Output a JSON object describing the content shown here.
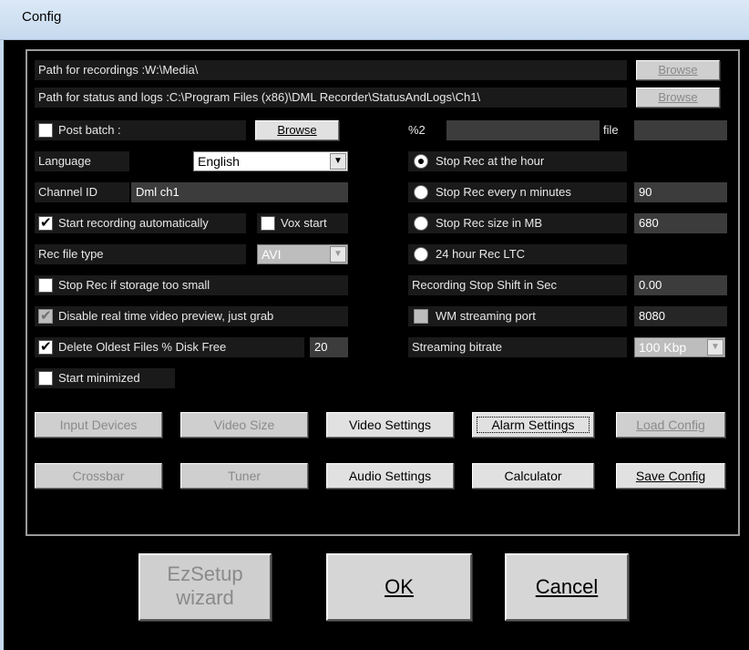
{
  "window": {
    "title": "Config"
  },
  "paths": {
    "recordings_label": "Path for recordings :W:\\Media\\",
    "status_label": "Path for status and logs :C:\\Program Files (x86)\\DML Recorder\\StatusAndLogs\\Ch1\\",
    "browse_recordings": "Browse",
    "browse_status": "Browse"
  },
  "post_batch": {
    "label": "Post batch :",
    "browse": "Browse",
    "checked": false
  },
  "pct_field": {
    "label": "%2",
    "file_label": "file"
  },
  "language": {
    "label": "Language",
    "value": "English"
  },
  "channel": {
    "label": "Channel ID",
    "value": "Dml ch1"
  },
  "start_auto": {
    "label": "Start recording automatically",
    "checked": true
  },
  "vox_start": {
    "label": "Vox start",
    "checked": false
  },
  "rec_file_type": {
    "label": "Rec file type",
    "value": "AVI"
  },
  "stop_rec_small": {
    "label": "Stop Rec if storage too small",
    "checked": false
  },
  "disable_preview": {
    "label": "Disable real time video preview, just grab",
    "checked": true
  },
  "delete_oldest": {
    "label": "Delete Oldest Files % Disk Free",
    "value": "20",
    "checked": true
  },
  "start_minimized": {
    "label": "Start minimized",
    "checked": false
  },
  "stop_options": {
    "hour": {
      "label": "Stop Rec at the hour",
      "checked": true
    },
    "minutes": {
      "label": "Stop Rec every n minutes",
      "value": "90"
    },
    "size": {
      "label": "Stop Rec size in MB",
      "value": "680"
    },
    "ltc": {
      "label": "24 hour Rec LTC"
    }
  },
  "stop_shift": {
    "label": "Recording Stop Shift in Sec",
    "value": "0.00"
  },
  "wm_streaming": {
    "label": "WM streaming port",
    "value": "8080",
    "checked": false
  },
  "streaming_bitrate": {
    "label": "Streaming bitrate",
    "value": "100 Kbp"
  },
  "buttons_row1": {
    "input_devices": "Input Devices",
    "video_size": "Video Size",
    "video_settings": "Video Settings",
    "alarm_settings": "Alarm Settings",
    "load_config": "Load Config"
  },
  "buttons_row2": {
    "crossbar": "Crossbar",
    "tuner": "Tuner",
    "audio_settings": "Audio Settings",
    "calculator": "Calculator",
    "save_config": "Save Config"
  },
  "bottom": {
    "ezsetup_line1": "EzSetup",
    "ezsetup_line2": "wizard",
    "ok": "OK",
    "cancel": "Cancel"
  }
}
